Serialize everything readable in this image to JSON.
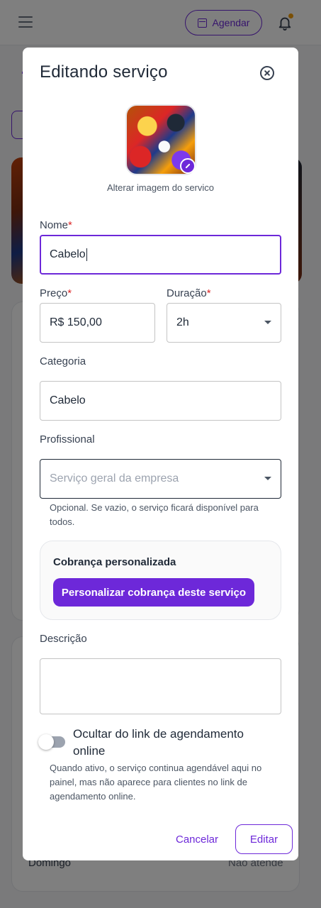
{
  "header": {
    "agendar_label": "Agendar"
  },
  "background": {
    "footer_day": "Domingo",
    "footer_status": "Não atende"
  },
  "modal": {
    "title": "Editando serviço",
    "image_caption": "Alterar imagem do servico",
    "name": {
      "label": "Nome",
      "required_mark": "*",
      "value": "Cabelo"
    },
    "price": {
      "label": "Preço",
      "required_mark": "*",
      "value": "R$ 150,00"
    },
    "duration": {
      "label": "Duração",
      "required_mark": "*",
      "value": "2h"
    },
    "category": {
      "label": "Categoria",
      "value": "Cabelo"
    },
    "professional": {
      "label": "Profissional",
      "placeholder": "Serviço geral da empresa",
      "helper_line1": "Opcional. Se vazio, o serviço ficará disponível para",
      "helper_line2": "todos."
    },
    "custom_billing": {
      "title": "Cobrança personalizada",
      "button_label": "Personalizar cobrança deste serviço"
    },
    "description": {
      "label": "Descrição",
      "value": ""
    },
    "hide_toggle": {
      "label": "Ocultar do link de agendamento online",
      "checked": false,
      "helper_line1": "Quando ativo, o serviço continua agendável aqui no",
      "helper_line2": "painel, mas não aparece para clientes no link de",
      "helper_line3": "agendamento online."
    },
    "cancel_label": "Cancelar",
    "submit_label": "Editar"
  },
  "colors": {
    "accent": "#6d28d9",
    "required": "#dc2626",
    "notification_dot": "#f59e0b"
  }
}
